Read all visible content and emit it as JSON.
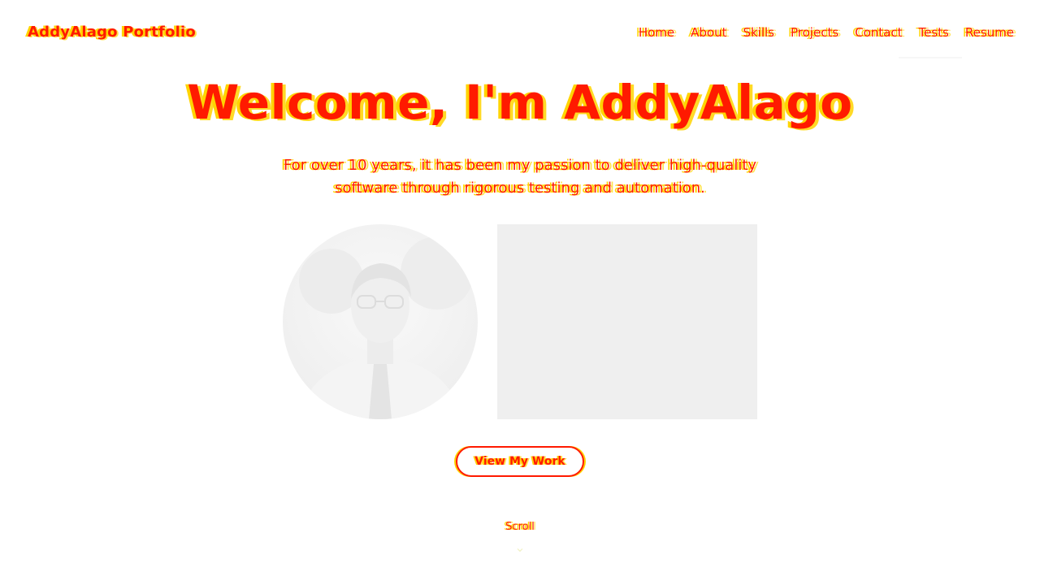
{
  "brand": "AddyAlago Portfolio",
  "nav": [
    {
      "label": "Home"
    },
    {
      "label": "About"
    },
    {
      "label": "Skills"
    },
    {
      "label": "Projects"
    },
    {
      "label": "Contact"
    },
    {
      "label": "Tests"
    },
    {
      "label": "Resume"
    }
  ],
  "hero": {
    "title": "Welcome, I'm AddyAlago",
    "subtitle_line1": "For over 10 years, it has been my passion to deliver high-quality",
    "subtitle_line2": "software through rigorous testing and automation.",
    "avatar_icon": "profile-photo",
    "cta_label": "View My Work"
  },
  "scroll": {
    "label": "Scroll",
    "icon": "chevron-down-icon"
  },
  "colors": {
    "primary": "#ff1a00",
    "ghost": "#ffd400",
    "media_placeholder": "#efefef"
  }
}
